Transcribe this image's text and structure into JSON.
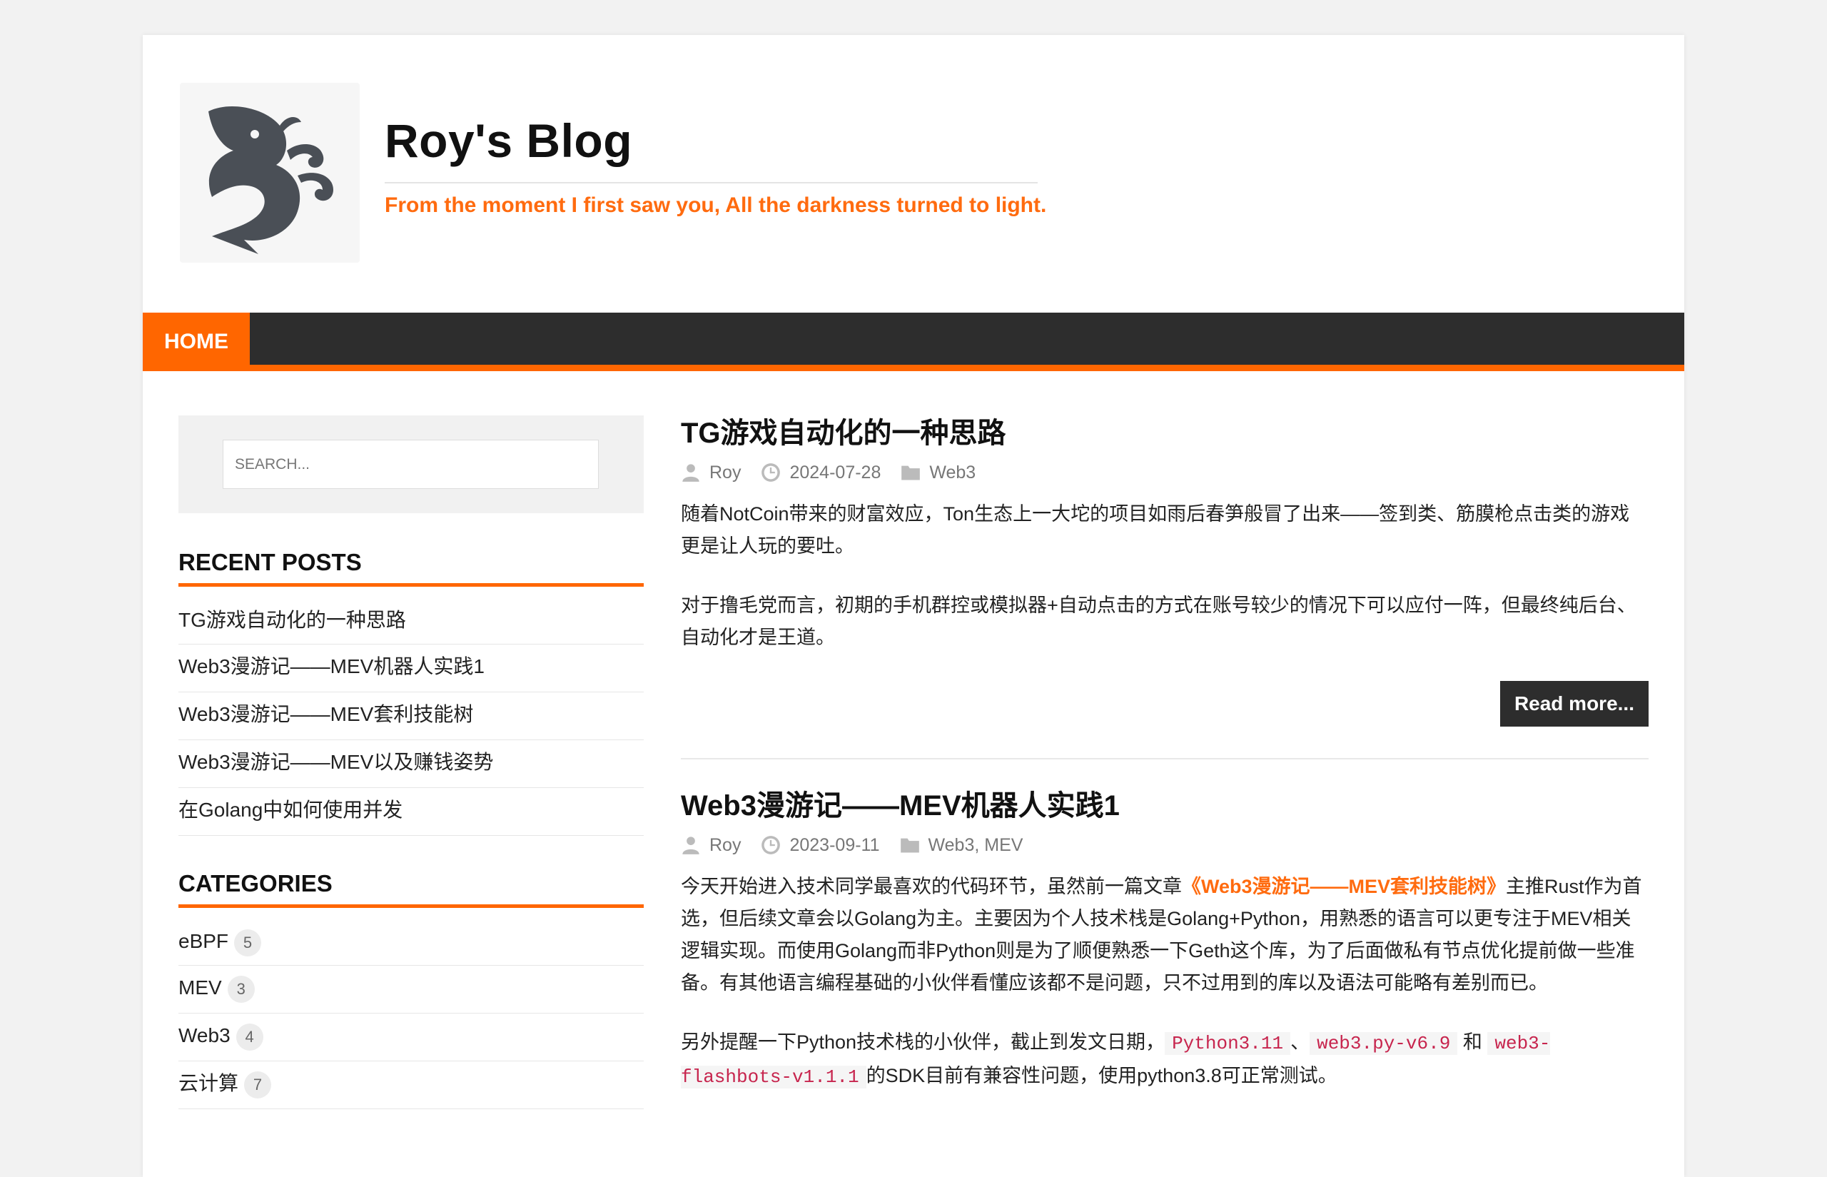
{
  "site": {
    "title": "Roy's Blog",
    "tagline": "From the moment I first saw you, All the darkness turned to light."
  },
  "nav": {
    "home_label": "HOME"
  },
  "search": {
    "placeholder": "SEARCH..."
  },
  "recent_posts": {
    "title": "RECENT POSTS",
    "items": [
      "TG游戏自动化的一种思路",
      "Web3漫游记——MEV机器人实践1",
      "Web3漫游记——MEV套利技能树",
      "Web3漫游记——MEV以及赚钱姿势",
      "在Golang中如何使用并发"
    ]
  },
  "categories": {
    "title": "CATEGORIES",
    "items": [
      {
        "name": "eBPF",
        "count": "5"
      },
      {
        "name": "MEV",
        "count": "3"
      },
      {
        "name": "Web3",
        "count": "4"
      },
      {
        "name": "云计算",
        "count": "7"
      }
    ]
  },
  "posts": [
    {
      "title": "TG游戏自动化的一种思路",
      "author": "Roy",
      "date": "2024-07-28",
      "categories": "Web3",
      "paragraphs": [
        "随着NotCoin带来的财富效应，Ton生态上一大坨的项目如雨后春笋般冒了出来——签到类、筋膜枪点击类的游戏更是让人玩的要吐。",
        "对于撸毛党而言，初期的手机群控或模拟器+自动点击的方式在账号较少的情况下可以应付一阵，但最终纯后台、自动化才是王道。"
      ],
      "read_more": "Read more..."
    },
    {
      "title": "Web3漫游记——MEV机器人实践1",
      "author": "Roy",
      "date": "2023-09-11",
      "categories": "Web3, MEV",
      "p1_before": "今天开始进入技术同学最喜欢的代码环节，虽然前一篇文章",
      "p1_link": "《Web3漫游记——MEV套利技能树》",
      "p1_after": "主推Rust作为首选，但后续文章会以Golang为主。主要因为个人技术栈是Golang+Python，用熟悉的语言可以更专注于MEV相关逻辑实现。而使用Golang而非Python则是为了顺便熟悉一下Geth这个库，为了后面做私有节点优化提前做一些准备。有其他语言编程基础的小伙伴看懂应该都不是问题，只不过用到的库以及语法可能略有差别而已。",
      "p2_before": "另外提醒一下Python技术栈的小伙伴，截止到发文日期，",
      "p2_code1": "Python3.11",
      "p2_sep1": "、",
      "p2_code2": "web3.py-v6.9",
      "p2_sep2": "和",
      "p2_code3": "web3-flashbots-v1.1.1",
      "p2_after": "的SDK目前有兼容性问题，使用python3.8可正常测试。"
    }
  ]
}
